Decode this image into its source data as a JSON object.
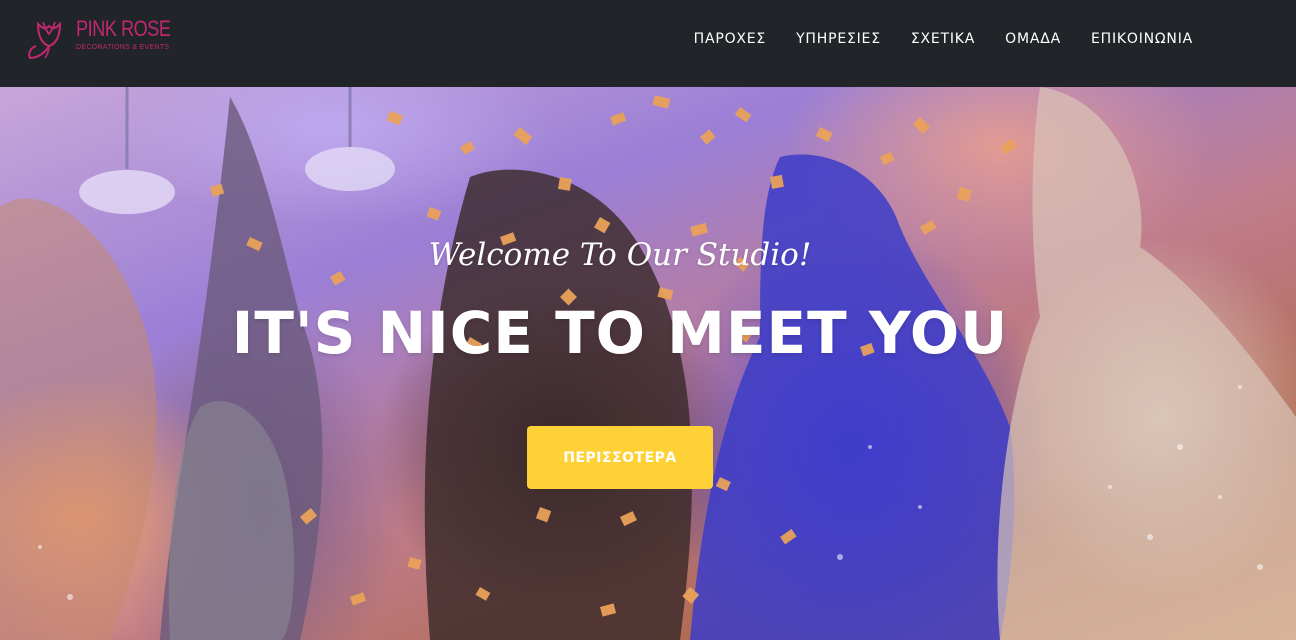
{
  "brand": {
    "title": "PINK ROSE",
    "subtitle": "DECORATIONS & EVENTS",
    "icon": "rose-logo-icon",
    "color": "#c2286f"
  },
  "nav": {
    "items": [
      {
        "label": "ΠΑΡΟΧΕΣ"
      },
      {
        "label": "ΥΠΗΡΕΣΙΕΣ"
      },
      {
        "label": "ΣΧΕΤΙΚΑ"
      },
      {
        "label": "ΟΜΑΔΑ"
      },
      {
        "label": "ΕΠΙΚΟΙΝΩΝΙΑ"
      }
    ]
  },
  "hero": {
    "subheading": "Welcome To Our Studio!",
    "heading": "IT'S NICE TO MEET YOU",
    "button_label": "ΠΕΡΙΣΣΟΤΕΡΑ",
    "button_color": "#fed136",
    "background": "party-confetti-photo"
  },
  "colors": {
    "navbar": "#212529",
    "accent": "#fed136"
  }
}
